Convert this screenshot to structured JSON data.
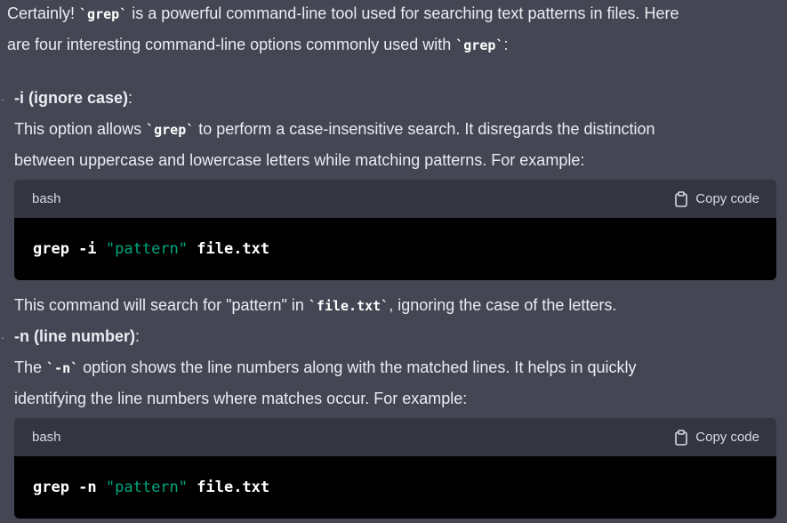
{
  "intro": {
    "line1_a": "Certainly! ",
    "line1_code": "`grep`",
    "line1_b": " is a powerful command-line tool used for searching text patterns in files. Here",
    "line2_a": "are four interesting command-line options commonly used with ",
    "line2_code": "`grep`",
    "line2_b": ":"
  },
  "options": [
    {
      "marker": ".",
      "heading": "-i (ignore case)",
      "heading_suffix": ":",
      "desc1_a": "This option allows ",
      "desc1_code": "`grep`",
      "desc1_b": " to perform a case-insensitive search. It disregards the distinction",
      "desc2": "between uppercase and lowercase letters while matching patterns. For example:",
      "code": {
        "lang": "bash",
        "copy_label": "Copy code",
        "cmd": "grep -i ",
        "arg": "\"pattern\"",
        "file": " file.txt"
      },
      "after_a": "This command will search for \"pattern\" in ",
      "after_code": "`file.txt`",
      "after_b": ", ignoring the case of the letters."
    },
    {
      "marker": ".",
      "heading": "-n (line number)",
      "heading_suffix": ":",
      "desc1_a": "The ",
      "desc1_code": "`-n`",
      "desc1_b": " option shows the line numbers along with the matched lines. It helps in quickly",
      "desc2": "identifying the line numbers where matches occur. For example:",
      "code": {
        "lang": "bash",
        "copy_label": "Copy code",
        "cmd": "grep -n ",
        "arg": "\"pattern\"",
        "file": " file.txt"
      }
    }
  ],
  "colors": {
    "background": "#444654",
    "code_header": "#343541",
    "code_body": "#000000",
    "string": "#00a67d"
  }
}
